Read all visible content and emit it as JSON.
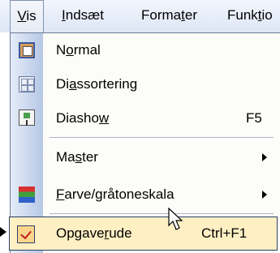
{
  "menubar": {
    "items": [
      {
        "pre": "",
        "key": "V",
        "post": "is"
      },
      {
        "pre": "",
        "key": "I",
        "post": "ndsæt"
      },
      {
        "pre": "Forma",
        "key": "t",
        "post": "er"
      },
      {
        "pre": "Funk",
        "key": "t",
        "post": "io"
      }
    ]
  },
  "menu": {
    "items": [
      {
        "pre": "N",
        "key": "o",
        "post": "rmal",
        "icon": "normal-view-icon"
      },
      {
        "pre": "Di",
        "key": "a",
        "post": "ssortering",
        "icon": "slide-sorter-icon"
      },
      {
        "pre": "Diasho",
        "key": "w",
        "post": "",
        "shortcut": "F5",
        "icon": "slide-show-icon"
      },
      {
        "pre": "Ma",
        "key": "s",
        "post": "ter",
        "submenu": true
      },
      {
        "pre": "",
        "key": "F",
        "post": "arve/gråtoneskala",
        "submenu": true,
        "icon": "color-grayscale-icon"
      },
      {
        "pre": "Opgave",
        "key": "r",
        "post": "ude",
        "shortcut": "Ctrl+F1",
        "checked": true,
        "highlighted": true
      }
    ]
  },
  "colors": {
    "menubar_bg": "#dde6f6",
    "gutter": "#b6c8e6",
    "highlight": "#fff0c4",
    "highlight_border": "#2b3e6a",
    "check": "#c02020"
  }
}
